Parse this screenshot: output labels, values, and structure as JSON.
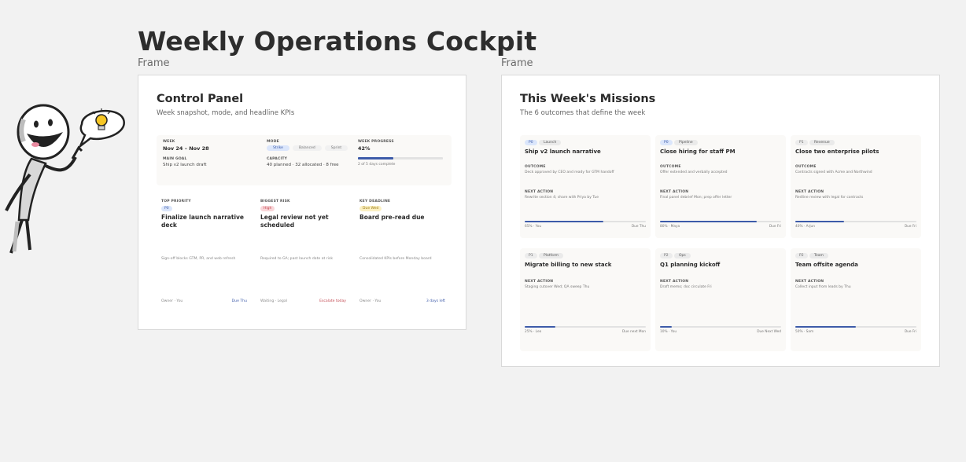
{
  "board": {
    "title": "Weekly Operations Cockpit"
  },
  "frames": {
    "left_label": "Frame",
    "right_label": "Frame"
  },
  "control_panel": {
    "title": "Control Panel",
    "subtitle": "Week snapshot, mode, and headline KPIs",
    "week": {
      "label": "WEEK",
      "value": "Nov 24 – Nov 28"
    },
    "mode": {
      "label": "MODE",
      "options": [
        "Strike",
        "Balanced",
        "Sprint"
      ],
      "selected_index": 0
    },
    "week_progress": {
      "label": "WEEK PROGRESS",
      "value": "42%",
      "fraction": 0.42,
      "caption": "2 of 5 days complete"
    },
    "main_goal": {
      "label": "MAIN GOAL",
      "value": "Ship v2 launch draft"
    },
    "capacity": {
      "label": "CAPACITY",
      "value": "40 planned · 32 allocated · 8 free"
    },
    "kpis": [
      {
        "label": "TOP PRIORITY",
        "chip": "P0",
        "chip_bg": "#dbe6fb",
        "chip_fg": "#3d5ba9",
        "title": "Finalize launch narrative deck",
        "desc": "Sign-off blocks GTM, PR, and web refresh",
        "footer_left": "Owner · You",
        "footer_right": "Due Thu",
        "footer_right_color": "#3d5ba9"
      },
      {
        "label": "BIGGEST RISK",
        "chip": "High",
        "chip_bg": "#f9d6d9",
        "chip_fg": "#c2464f",
        "title": "Legal review not yet scheduled",
        "desc": "Required to GA; past launch date at risk",
        "footer_left": "Waiting · Legal",
        "footer_right": "Escalate today",
        "footer_right_color": "#c2464f"
      },
      {
        "label": "KEY DEADLINE",
        "chip": "Due Wed",
        "chip_bg": "#fbf0c2",
        "chip_fg": "#9a7a14",
        "title": "Board pre-read due",
        "desc": "Consolidated KPIs before Monday board",
        "footer_left": "Owner · You",
        "footer_right": "3 days left",
        "footer_right_color": "#3d5ba9"
      }
    ]
  },
  "missions": {
    "title": "This Week's Missions",
    "subtitle": "The 6 outcomes that define the week",
    "outcome_label": "OUTCOME",
    "next_action_label": "NEXT ACTION",
    "cards": [
      {
        "priority": "P0",
        "priority_bg": "#dbe6fb",
        "priority_fg": "#3d5ba9",
        "status": "Launch",
        "title": "Ship v2 launch narrative",
        "outcome": "Deck approved by CEO and ready for GTM handoff",
        "next_action": "Rewrite section 4; share with Priya by Tue",
        "progress": 0.65,
        "progress_text": "65% · You",
        "due": "Due Thu"
      },
      {
        "priority": "P0",
        "priority_bg": "#dbe6fb",
        "priority_fg": "#3d5ba9",
        "status": "Pipeline",
        "title": "Close hiring for staff PM",
        "outcome": "Offer extended and verbally accepted",
        "next_action": "Final panel debrief Mon; prep offer letter",
        "progress": 0.8,
        "progress_text": "80% · Maya",
        "due": "Due Fri"
      },
      {
        "priority": "P1",
        "priority_bg": "#ececec",
        "priority_fg": "#666666",
        "status": "Revenue",
        "title": "Close two enterprise pilots",
        "outcome": "Contracts signed with Acme and Northwind",
        "next_action": "Redline review with legal for contracts",
        "progress": 0.4,
        "progress_text": "40% · Arjun",
        "due": "Due Fri"
      },
      {
        "priority": "P1",
        "priority_bg": "#ececec",
        "priority_fg": "#666666",
        "status": "Platform",
        "title": "Migrate billing to new stack",
        "outcome": "",
        "next_action": "Staging cutover Wed; QA sweep Thu",
        "progress": 0.25,
        "progress_text": "25% · Leo",
        "due": "Due next Mon"
      },
      {
        "priority": "P2",
        "priority_bg": "#ececec",
        "priority_fg": "#666666",
        "status": "Ops",
        "title": "Q1 planning kickoff",
        "outcome": "",
        "next_action": "Draft memo; doc circulate Fri",
        "progress": 0.1,
        "progress_text": "10% · You",
        "due": "Due Next Wed"
      },
      {
        "priority": "P2",
        "priority_bg": "#ececec",
        "priority_fg": "#666666",
        "status": "Team",
        "title": "Team offsite agenda",
        "outcome": "",
        "next_action": "Collect input from leads by Thu",
        "progress": 0.5,
        "progress_text": "50% · Sam",
        "due": "Due Fri"
      }
    ]
  }
}
